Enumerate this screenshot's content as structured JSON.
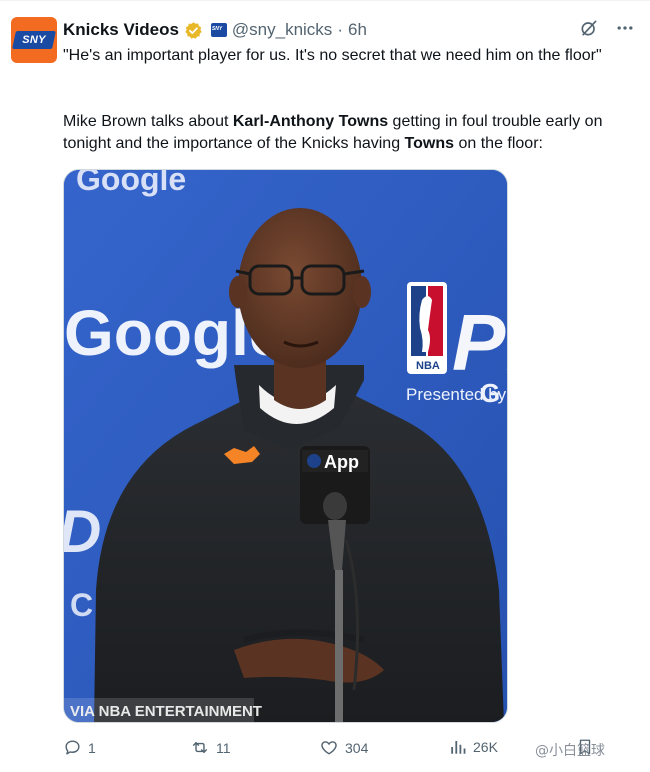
{
  "tweet": {
    "display_name": "Knicks Videos",
    "handle": "@sny_knicks",
    "separator": "·",
    "time": "6h",
    "avatar_text": "SNY",
    "affiliate_badge_text": "SNY",
    "quote": "\"He's an important player for us. It's no secret that we need him on the floor\"",
    "desc_parts": {
      "p1": "Mike Brown talks about ",
      "b1": "Karl-Anthony Towns",
      "p2": " getting in foul trouble early on tonight and the importance of the Knicks having ",
      "b2": "Towns",
      "p3": " on the floor:"
    }
  },
  "media": {
    "backdrop_words": {
      "google_top": "Google",
      "google_main": "Google",
      "nba_logo": "NBA",
      "playoffs_partial": "PL",
      "presented_by": "Presented by",
      "presented_brand": "G",
      "left_partial_1": "D",
      "left_partial_2": "C"
    },
    "mic_flag_text": "App",
    "caption": "VIA NBA ENTERTAINMENT"
  },
  "actions": {
    "replies": "1",
    "reposts": "11",
    "likes": "304",
    "views": "26K"
  },
  "watermark": "@小白篮球",
  "colors": {
    "verified": "#e8b829",
    "sny_orange": "#f26b21",
    "sny_blue": "#1b4aa3",
    "backdrop_blue": "#2c5ac0",
    "muted_text": "#536471"
  }
}
